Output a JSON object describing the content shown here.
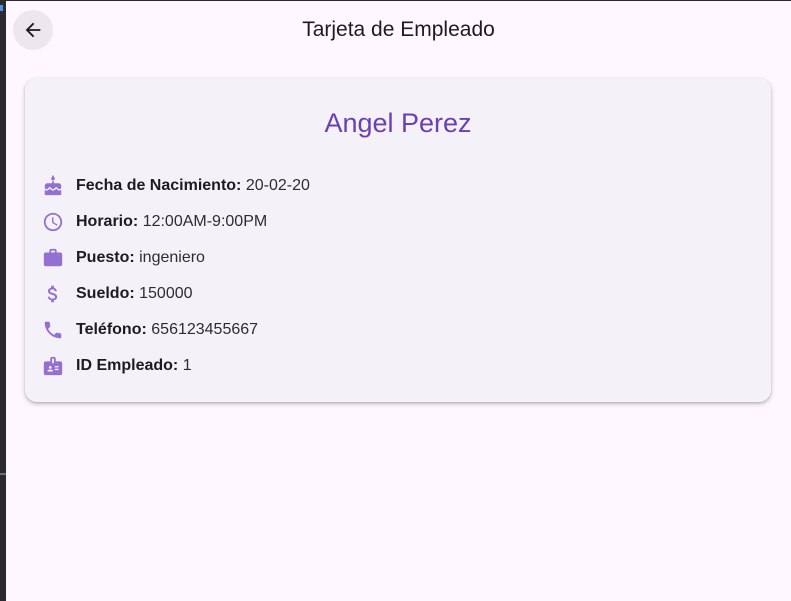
{
  "colors": {
    "background": "#fef7ff",
    "card": "#f5f1f8",
    "accent": "#6a3fb5",
    "icon": "#9470d0"
  },
  "appbar": {
    "title": "Tarjeta de Empleado",
    "back_icon": "arrow-back-icon"
  },
  "employee": {
    "name": "Angel Perez",
    "rows": [
      {
        "icon": "cake-icon",
        "label": "Fecha de Nacimiento:",
        "value": "20-02-20"
      },
      {
        "icon": "clock-icon",
        "label": "Horario:",
        "value": "12:00AM-9:00PM"
      },
      {
        "icon": "briefcase-icon",
        "label": "Puesto:",
        "value": "ingeniero"
      },
      {
        "icon": "dollar-icon",
        "label": "Sueldo:",
        "value": "150000"
      },
      {
        "icon": "phone-icon",
        "label": "Teléfono:",
        "value": "656123455667"
      },
      {
        "icon": "badge-icon",
        "label": "ID Empleado:",
        "value": "1"
      }
    ]
  }
}
